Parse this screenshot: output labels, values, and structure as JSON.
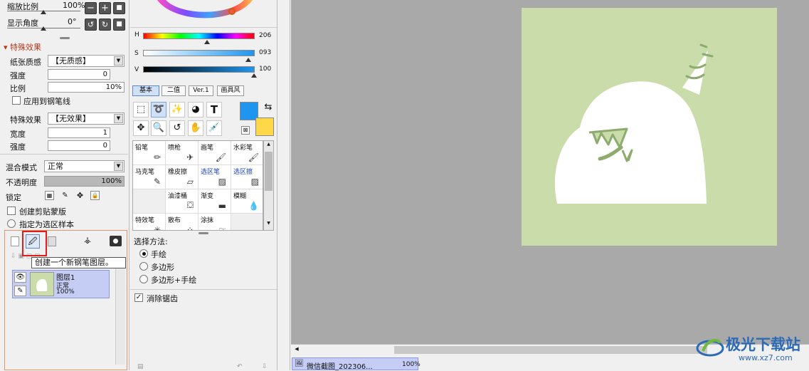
{
  "nav": {
    "zoom_label": "缩放比例",
    "zoom_value": "100%",
    "angle_label": "显示角度",
    "angle_value": "0°"
  },
  "effects": {
    "section_title": "特殊效果",
    "paper_label": "纸张质感",
    "paper_value": "【无质感】",
    "strength_label": "强度",
    "strength_value": "0",
    "scale_label": "比例",
    "scale_value": "10%",
    "apply_pen_label": "应用到钢笔线",
    "effect_label": "特殊效果",
    "effect_value": "【无效果】",
    "width_label": "宽度",
    "width_value": "1",
    "strength2_label": "强度",
    "strength2_value": "0"
  },
  "layer_props": {
    "blend_label": "混合模式",
    "blend_value": "正常",
    "opacity_label": "不透明度",
    "opacity_value": "100%",
    "lock_label": "锁定",
    "clip_label": "创建剪贴蒙版",
    "sample_label": "指定为选区样本"
  },
  "tooltip": "创建一个新钢笔图层。",
  "layer": {
    "name": "图层1",
    "mode": "正常",
    "opacity": "100%"
  },
  "hsv": {
    "h_label": "H",
    "h_value": "206",
    "s_label": "S",
    "s_value": "093",
    "v_label": "V",
    "v_value": "100",
    "h_fraction": 0.57,
    "s_fraction": 0.93,
    "v_fraction": 1.0
  },
  "color_tabs": [
    "基本",
    "二值",
    "Ver.1",
    "画具风"
  ],
  "brushes": [
    {
      "name": "铅笔",
      "icon": "pencil-icon"
    },
    {
      "name": "喷枪",
      "icon": "airbrush-icon"
    },
    {
      "name": "画笔",
      "icon": "brush-icon"
    },
    {
      "name": "水彩笔",
      "icon": "watercolor-icon"
    },
    {
      "name": "马克笔",
      "icon": "marker-icon"
    },
    {
      "name": "橡皮擦",
      "icon": "eraser-icon"
    },
    {
      "name": "选区笔",
      "icon": "select-pen-icon"
    },
    {
      "name": "选区擦",
      "icon": "select-eraser-icon"
    },
    {
      "name": "",
      "icon": ""
    },
    {
      "name": "油漆桶",
      "icon": "bucket-icon"
    },
    {
      "name": "渐变",
      "icon": "gradient-icon"
    },
    {
      "name": "模糊",
      "icon": "blur-icon"
    },
    {
      "name": "特效笔",
      "icon": "effect-pen-icon"
    },
    {
      "name": "散布",
      "icon": "scatter-icon"
    },
    {
      "name": "涂抹",
      "icon": "smudge-icon"
    },
    {
      "name": "",
      "icon": ""
    }
  ],
  "selection": {
    "method_label": "选择方法:",
    "options": [
      "手绘",
      "多边形",
      "多边形+手绘"
    ],
    "antialias_label": "消除锯齿"
  },
  "colors": {
    "primary": "#1e96f0",
    "secondary": "#ffd84a",
    "canvas_bg": "#c9dcaa",
    "workspace": "#a9a9a9"
  },
  "status": {
    "file_name": "微信截图_202306...",
    "zoom": "100%"
  },
  "watermark": {
    "text": "极光下载站",
    "url": "www.xz7.com"
  }
}
